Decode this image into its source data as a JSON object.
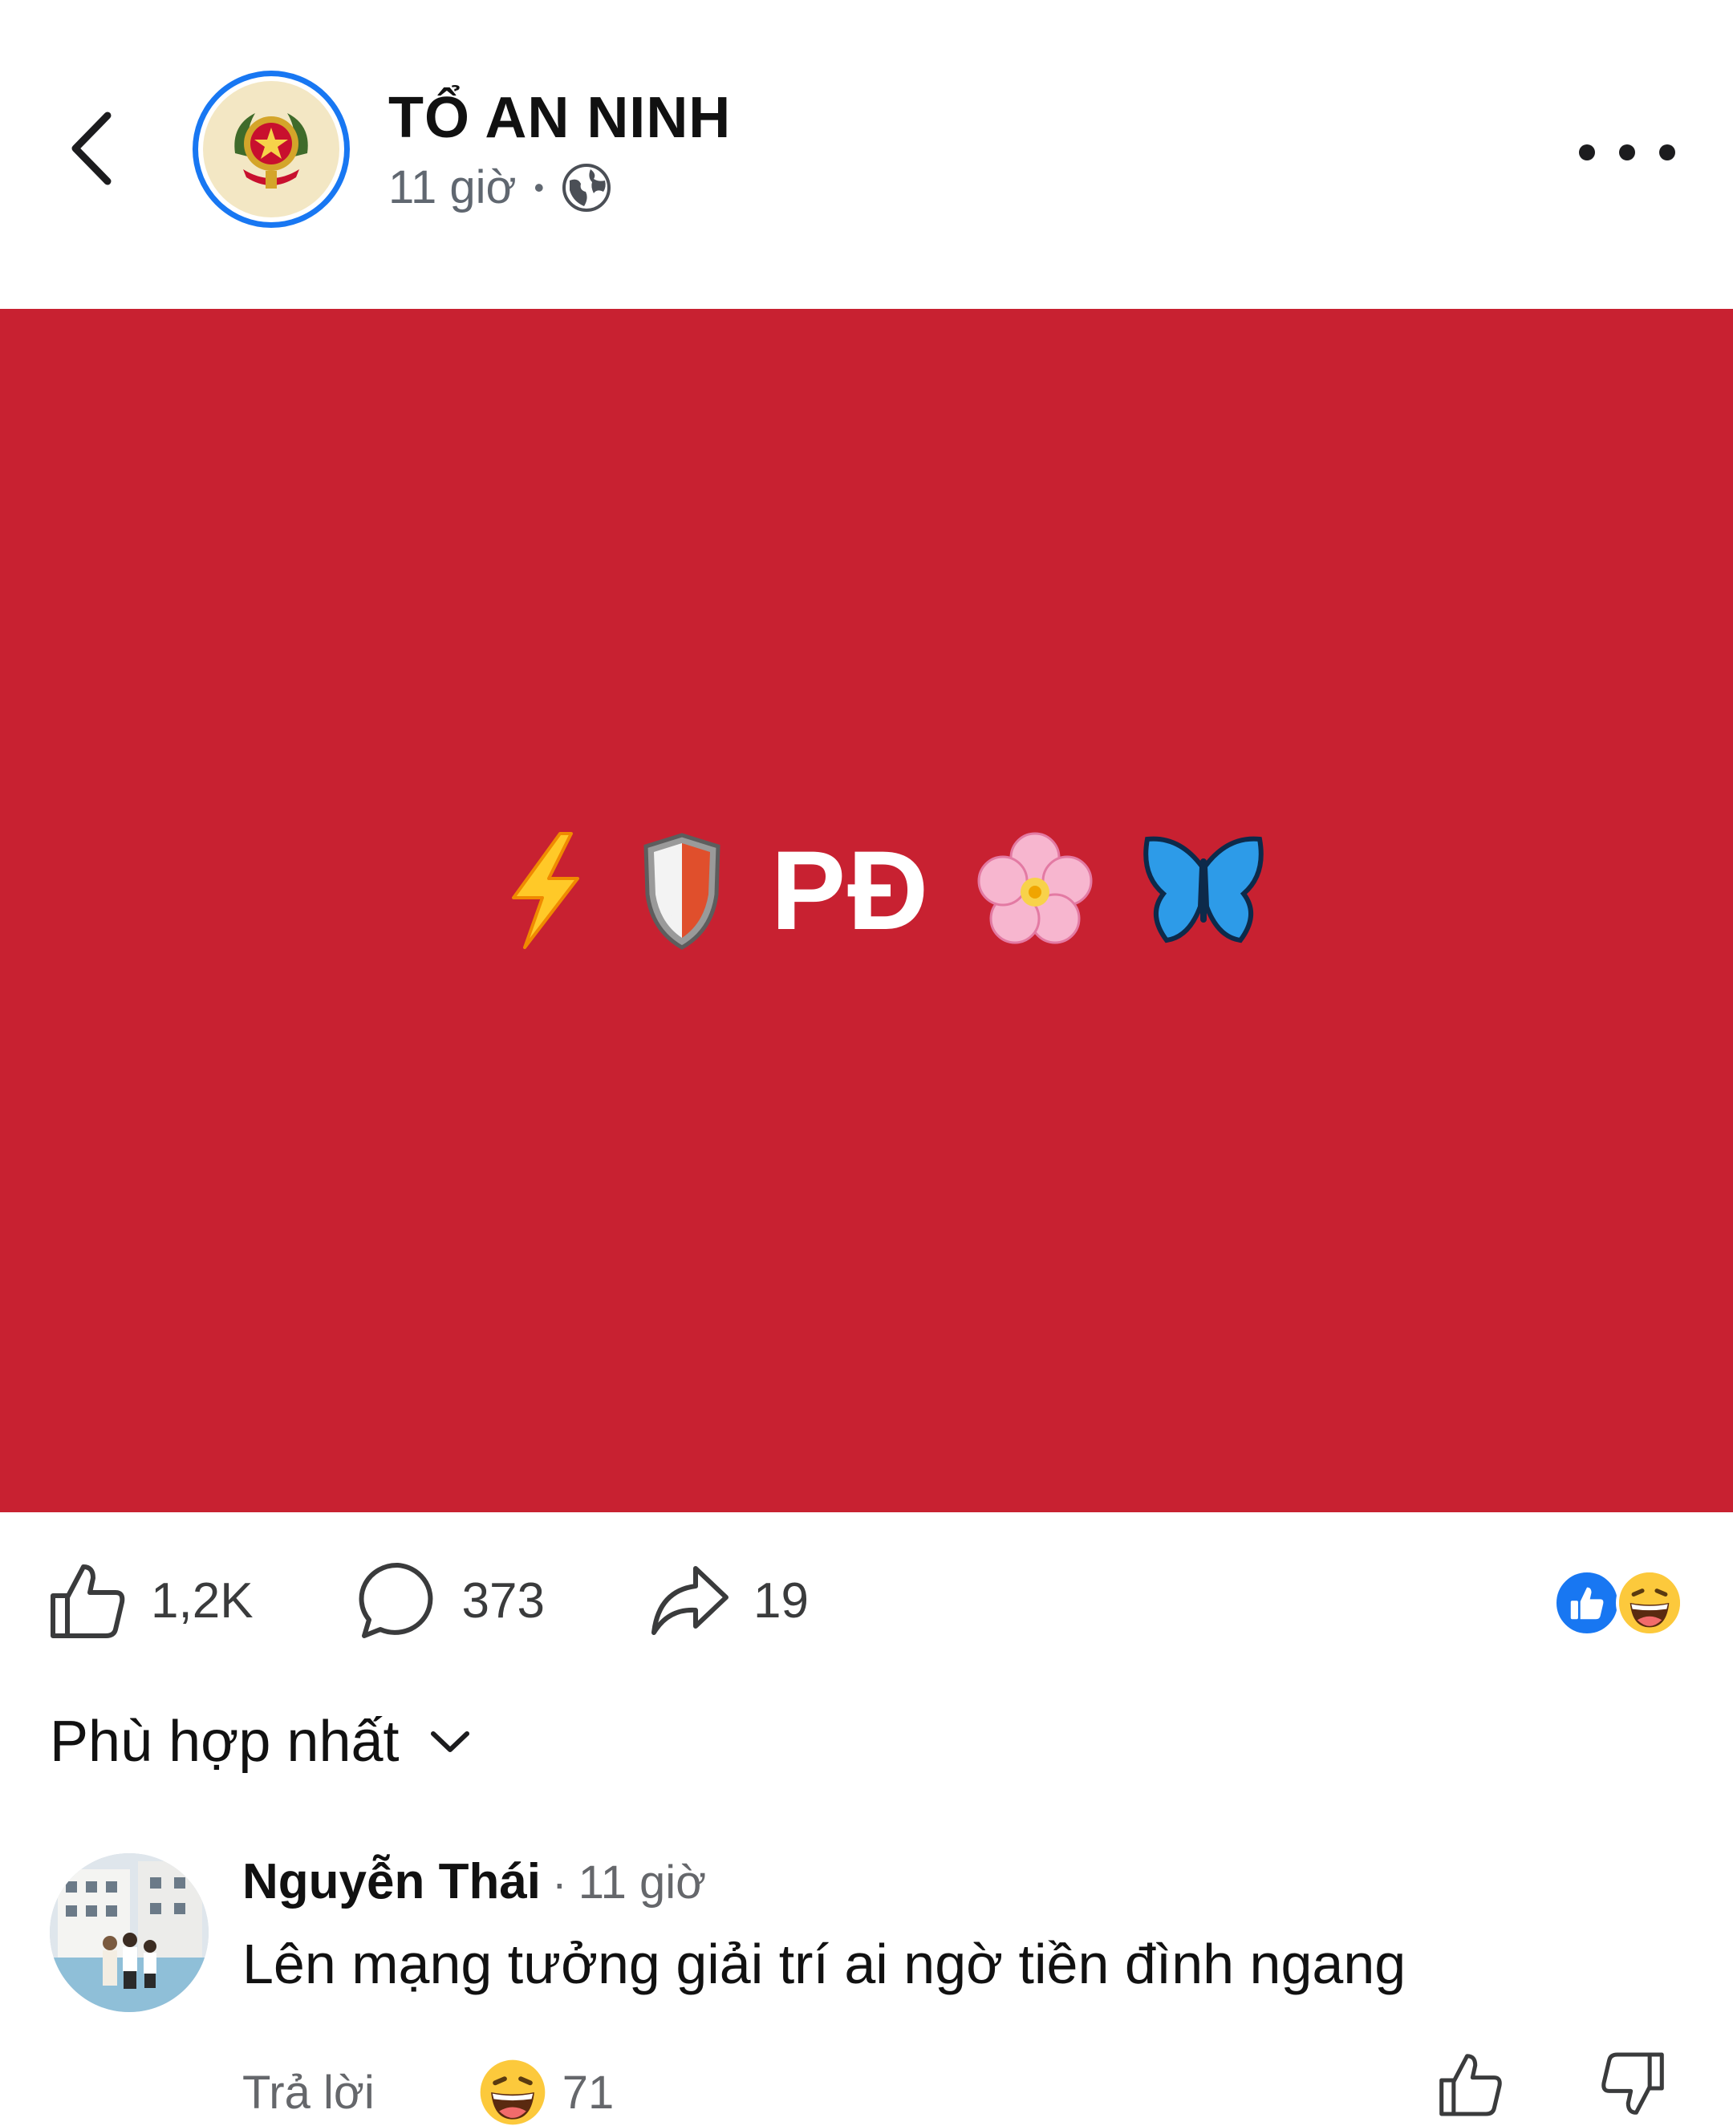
{
  "header": {
    "page_name": "TỔ AN NINH",
    "time": "11 giờ",
    "separator": "•",
    "privacy_icon": "globe-icon",
    "back_icon": "chevron-left-icon",
    "more_icon": "more-horizontal-icon"
  },
  "post": {
    "background_color": "#c82131",
    "banner": {
      "emoji_left_1": "lightning-icon",
      "emoji_left_2": "shield-icon",
      "text": "PĐ",
      "emoji_right_1": "cherry-blossom-icon",
      "emoji_right_2": "butterfly-icon"
    }
  },
  "actions": {
    "like_count": "1,2K",
    "comment_count": "373",
    "share_count": "19",
    "reaction_icons": [
      "like-reaction-icon",
      "haha-reaction-icon"
    ]
  },
  "comments_sort": {
    "label": "Phù hợp nhất"
  },
  "comment": {
    "author": "Nguyễn Thái",
    "separator": "·",
    "time": "11 giờ",
    "text": "Lên mạng tưởng giải trí ai ngờ tiền đình ngang",
    "reply_label": "Trả lời",
    "reaction_count": "71"
  },
  "colors": {
    "accent_blue": "#1877f2",
    "post_red": "#c82131",
    "muted_text": "#65676b"
  }
}
